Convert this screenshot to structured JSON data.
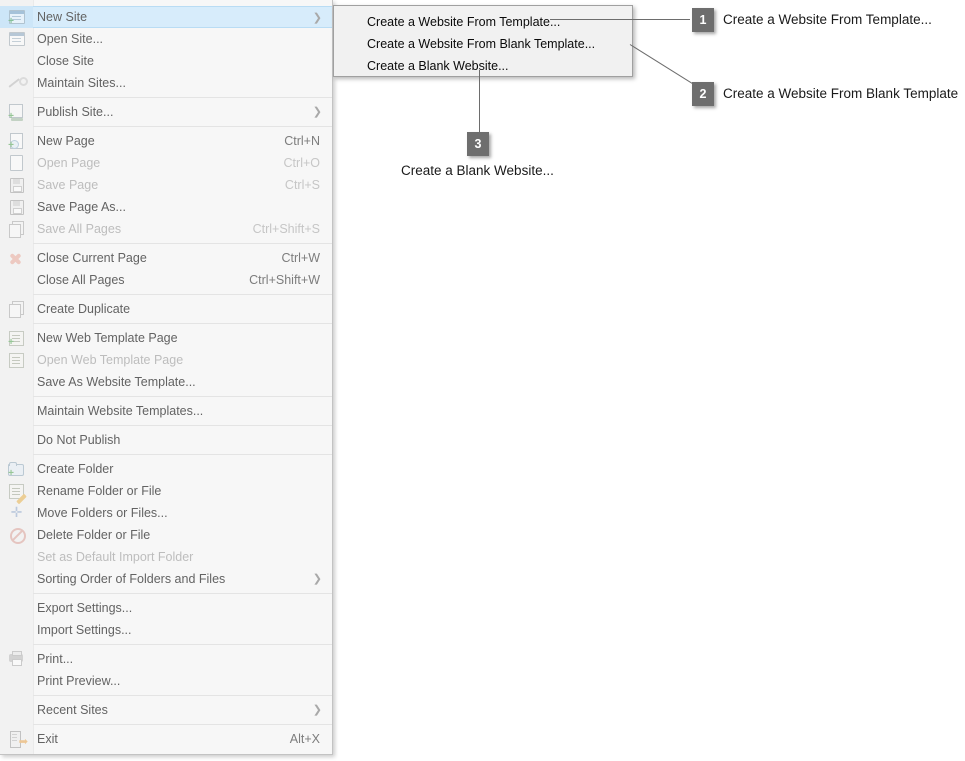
{
  "menu": {
    "groups": [
      {
        "items": [
          {
            "label": "New Site",
            "accel": "",
            "icon": "new-site-icon",
            "state": "selected",
            "submenu": true
          },
          {
            "label": "Open Site...",
            "accel": "",
            "icon": "open-site-icon",
            "state": "normal",
            "submenu": false
          },
          {
            "label": "Close Site",
            "accel": "",
            "icon": "",
            "state": "normal",
            "submenu": false
          },
          {
            "label": "Maintain Sites...",
            "accel": "",
            "icon": "wrench-icon",
            "state": "normal",
            "submenu": false
          }
        ]
      },
      {
        "items": [
          {
            "label": "Publish Site...",
            "accel": "",
            "icon": "publish-site-icon",
            "state": "normal",
            "submenu": true
          }
        ]
      },
      {
        "items": [
          {
            "label": "New Page",
            "accel": "Ctrl+N",
            "icon": "new-page-icon",
            "state": "normal",
            "submenu": false
          },
          {
            "label": "Open Page",
            "accel": "Ctrl+O",
            "icon": "open-page-icon",
            "state": "disabled",
            "submenu": false
          },
          {
            "label": "Save Page",
            "accel": "Ctrl+S",
            "icon": "save-page-icon",
            "state": "disabled",
            "submenu": false
          },
          {
            "label": "Save Page As...",
            "accel": "",
            "icon": "save-page-as-icon",
            "state": "normal",
            "submenu": false
          },
          {
            "label": "Save All Pages",
            "accel": "Ctrl+Shift+S",
            "icon": "save-all-pages-icon",
            "state": "disabled",
            "submenu": false
          }
        ]
      },
      {
        "items": [
          {
            "label": "Close Current Page",
            "accel": "Ctrl+W",
            "icon": "close-page-icon",
            "state": "normal",
            "submenu": false
          },
          {
            "label": "Close All Pages",
            "accel": "Ctrl+Shift+W",
            "icon": "",
            "state": "normal",
            "submenu": false
          }
        ]
      },
      {
        "items": [
          {
            "label": "Create Duplicate",
            "accel": "",
            "icon": "duplicate-icon",
            "state": "normal",
            "submenu": false
          }
        ]
      },
      {
        "items": [
          {
            "label": "New Web Template Page",
            "accel": "",
            "icon": "new-web-template-icon",
            "state": "normal",
            "submenu": false
          },
          {
            "label": "Open Web Template Page",
            "accel": "",
            "icon": "open-web-template-icon",
            "state": "disabled",
            "submenu": false
          },
          {
            "label": "Save As Website Template...",
            "accel": "",
            "icon": "",
            "state": "normal",
            "submenu": false
          }
        ]
      },
      {
        "items": [
          {
            "label": "Maintain Website Templates...",
            "accel": "",
            "icon": "",
            "state": "normal",
            "submenu": false
          }
        ]
      },
      {
        "items": [
          {
            "label": "Do Not Publish",
            "accel": "",
            "icon": "",
            "state": "normal",
            "submenu": false
          }
        ]
      },
      {
        "items": [
          {
            "label": "Create Folder",
            "accel": "",
            "icon": "create-folder-icon",
            "state": "normal",
            "submenu": false
          },
          {
            "label": "Rename Folder or File",
            "accel": "",
            "icon": "rename-icon",
            "state": "normal",
            "submenu": false
          },
          {
            "label": "Move Folders or Files...",
            "accel": "",
            "icon": "move-icon",
            "state": "normal",
            "submenu": false
          },
          {
            "label": "Delete Folder or File",
            "accel": "",
            "icon": "delete-icon",
            "state": "normal",
            "submenu": false
          },
          {
            "label": "Set as Default Import Folder",
            "accel": "",
            "icon": "",
            "state": "disabled",
            "submenu": false
          },
          {
            "label": "Sorting Order of Folders and Files",
            "accel": "",
            "icon": "",
            "state": "normal",
            "submenu": true
          }
        ]
      },
      {
        "items": [
          {
            "label": "Export Settings...",
            "accel": "",
            "icon": "",
            "state": "normal",
            "submenu": false
          },
          {
            "label": "Import Settings...",
            "accel": "",
            "icon": "",
            "state": "normal",
            "submenu": false
          }
        ]
      },
      {
        "items": [
          {
            "label": "Print...",
            "accel": "",
            "icon": "printer-icon",
            "state": "normal",
            "submenu": false
          },
          {
            "label": "Print Preview...",
            "accel": "",
            "icon": "",
            "state": "normal",
            "submenu": false
          }
        ]
      },
      {
        "items": [
          {
            "label": "Recent Sites",
            "accel": "",
            "icon": "",
            "state": "normal",
            "submenu": true
          }
        ]
      },
      {
        "items": [
          {
            "label": "Exit",
            "accel": "Alt+X",
            "icon": "exit-icon",
            "state": "normal",
            "submenu": false
          }
        ]
      }
    ]
  },
  "submenu": {
    "items": [
      {
        "label": "Create a Website From Template..."
      },
      {
        "label": "Create a Website From Blank Template..."
      },
      {
        "label": "Create a Blank Website..."
      }
    ]
  },
  "callouts": [
    {
      "number": "1",
      "label": "Create a Website From Template..."
    },
    {
      "number": "2",
      "label": "Create a Website From Blank Template"
    },
    {
      "number": "3",
      "label": "Create a Blank Website..."
    }
  ],
  "colors": {
    "badge": "#6e6e6e",
    "selection": "#d7ecfb",
    "menu_background": "#f7f7f7",
    "submenu_background": "#f1f1f1",
    "leader_line": "#6d6d6d"
  }
}
